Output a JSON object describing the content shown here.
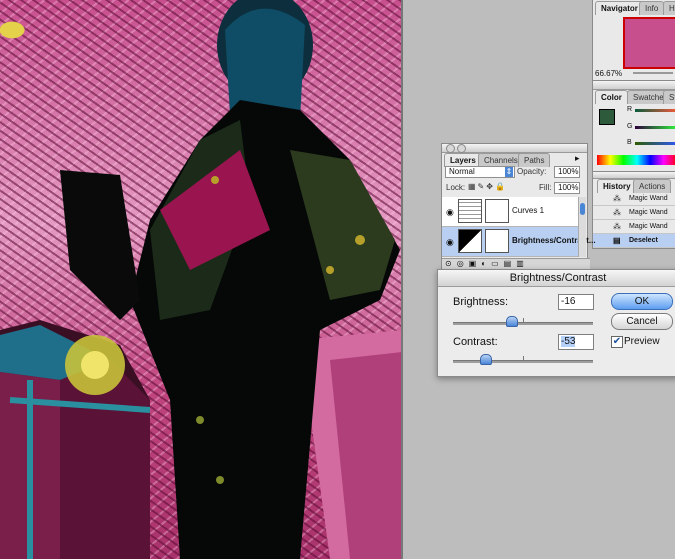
{
  "navigator": {
    "tabs": [
      "Navigator",
      "Info",
      "Hi"
    ],
    "zoom": "66.67%"
  },
  "color": {
    "tabs": [
      "Color",
      "Swatches",
      "St"
    ],
    "channels": [
      "R",
      "G",
      "B"
    ],
    "foreground": "#2e5a3c"
  },
  "layers": {
    "tabs": [
      "Layers",
      "Channels",
      "Paths"
    ],
    "blend_mode": "Normal",
    "opacity_label": "Opacity:",
    "opacity": "100%",
    "lock_label": "Lock:",
    "fill_label": "Fill:",
    "fill": "100%",
    "items": [
      {
        "name": "Curves 1"
      },
      {
        "name": "Brightness/Contrast..."
      }
    ]
  },
  "history": {
    "tabs": [
      "History",
      "Actions"
    ],
    "items": [
      "Magic Wand",
      "Magic Wand",
      "Magic Wand",
      "Deselect"
    ]
  },
  "dialog": {
    "title": "Brightness/Contrast",
    "brightness_label": "Brightness:",
    "brightness_value": "-16",
    "contrast_label": "Contrast:",
    "contrast_value": "-53",
    "ok_label": "OK",
    "cancel_label": "Cancel",
    "preview_label": "Preview",
    "preview_checked": true
  }
}
